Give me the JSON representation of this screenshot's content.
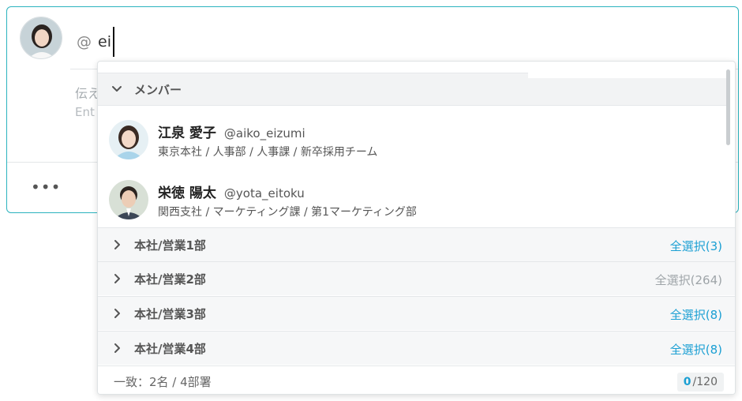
{
  "composer": {
    "mention_prefix": "@",
    "mention_query": "ei",
    "hint_line1": "伝え",
    "hint_line2": "Ent",
    "more_label": "•••"
  },
  "dropdown": {
    "section_label": "メンバー",
    "members": [
      {
        "name": "江泉 愛子",
        "handle": "@aiko_eizumi",
        "dept": "東京本社 / 人事部 / 人事課 / 新卒採用チーム"
      },
      {
        "name": "栄徳 陽太",
        "handle": "@yota_eitoku",
        "dept": "関西支社 / マーケティング課 / 第1マーケティング部"
      }
    ],
    "groups": [
      {
        "label": "本社/営業1部",
        "select_all": "全選択(3)",
        "enabled": true
      },
      {
        "label": "本社/営業2部",
        "select_all": "全選択(264)",
        "enabled": false
      },
      {
        "label": "本社/営業3部",
        "select_all": "全選択(8)",
        "enabled": true
      },
      {
        "label": "本社/営業4部",
        "select_all": "全選択(8)",
        "enabled": true
      }
    ],
    "status_text": "一致：2名 / 4部署",
    "counter_current": "0",
    "counter_max": "/120"
  },
  "colors": {
    "accent": "#1a9fd3",
    "border_teal": "#2bb3be",
    "disabled": "#9ea4a8"
  },
  "icons": {
    "expand": "chevron-down-icon",
    "collapse": "chevron-right-icon",
    "more": "more-dots-icon"
  }
}
